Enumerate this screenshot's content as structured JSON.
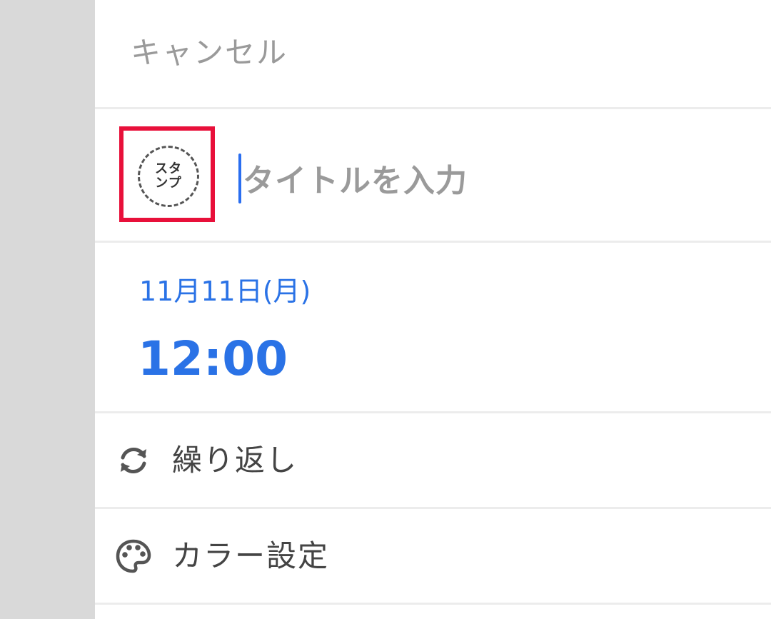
{
  "header": {
    "cancel_label": "キャンセル"
  },
  "stamp": {
    "line1": "スタ",
    "line2": "ンプ"
  },
  "title_input": {
    "placeholder": "タイトルを入力",
    "value": ""
  },
  "datetime": {
    "date": "11月11日(月)",
    "time": "12:00"
  },
  "menu": {
    "repeat_label": "繰り返し",
    "color_label": "カラー設定"
  },
  "colors": {
    "accent": "#2a72e6",
    "highlight_frame": "#e8103a",
    "muted_text": "#9a9a9a",
    "sidebar": "#d9d9d9"
  }
}
